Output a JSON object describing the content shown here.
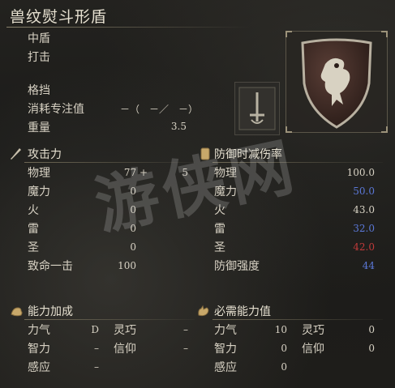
{
  "item": {
    "name": "兽纹熨斗形盾",
    "type": "中盾",
    "attack_type": "打击",
    "skill": "格挡",
    "fp_cost_label": "消耗专注值",
    "fp_cost_value": "－（　－／　－）",
    "weight_label": "重量",
    "weight_value": "3.5"
  },
  "attack": {
    "header": "攻击力",
    "rows": [
      {
        "label": "物理",
        "value": "77 +",
        "extra": "5"
      },
      {
        "label": "魔力",
        "value": "0"
      },
      {
        "label": "火",
        "value": "0"
      },
      {
        "label": "雷",
        "value": "0"
      },
      {
        "label": "圣",
        "value": "0"
      },
      {
        "label": "致命一击",
        "value": "100"
      }
    ]
  },
  "defense": {
    "header": "防御时减伤率",
    "rows": [
      {
        "label": "物理",
        "value": "100.0"
      },
      {
        "label": "魔力",
        "value": "50.0"
      },
      {
        "label": "火",
        "value": "43.0"
      },
      {
        "label": "雷",
        "value": "32.0"
      },
      {
        "label": "圣",
        "value": "42.0"
      },
      {
        "label": "防御强度",
        "value": "44"
      }
    ]
  },
  "scaling": {
    "header": "能力加成",
    "rows": [
      {
        "a_label": "力气",
        "a_value": "D",
        "b_label": "灵巧",
        "b_value": "–"
      },
      {
        "a_label": "智力",
        "a_value": "–",
        "b_label": "信仰",
        "b_value": "–"
      },
      {
        "a_label": "感应",
        "a_value": "–"
      }
    ]
  },
  "requirements": {
    "header": "必需能力值",
    "rows": [
      {
        "a_label": "力气",
        "a_value": "10",
        "b_label": "灵巧",
        "b_value": "0"
      },
      {
        "a_label": "智力",
        "a_value": "0",
        "b_label": "信仰",
        "b_value": "0"
      },
      {
        "a_label": "感应",
        "a_value": "0"
      }
    ]
  },
  "watermark": "游侠网",
  "icons": {
    "attack": "sword-icon",
    "defense": "shield-icon",
    "scaling": "arm-icon",
    "requirements": "hand-icon",
    "skill": "sword-in-shield-icon",
    "item": "lion-shield-icon"
  },
  "colors": {
    "magic": "#5b78d8",
    "lightning": "#5b78d8",
    "holy": "#c23a3a",
    "guard_boost": "#5b78d8"
  }
}
